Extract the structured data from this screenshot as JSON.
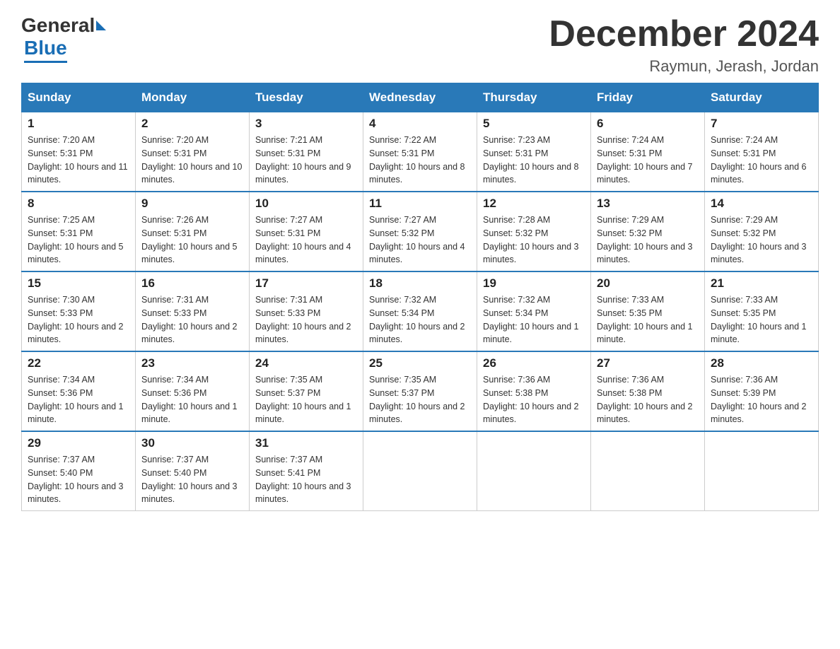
{
  "header": {
    "logo": {
      "general": "General",
      "blue": "Blue"
    },
    "title": "December 2024",
    "subtitle": "Raymun, Jerash, Jordan"
  },
  "columns": [
    "Sunday",
    "Monday",
    "Tuesday",
    "Wednesday",
    "Thursday",
    "Friday",
    "Saturday"
  ],
  "weeks": [
    [
      {
        "day": "1",
        "sunrise": "7:20 AM",
        "sunset": "5:31 PM",
        "daylight": "10 hours and 11 minutes."
      },
      {
        "day": "2",
        "sunrise": "7:20 AM",
        "sunset": "5:31 PM",
        "daylight": "10 hours and 10 minutes."
      },
      {
        "day": "3",
        "sunrise": "7:21 AM",
        "sunset": "5:31 PM",
        "daylight": "10 hours and 9 minutes."
      },
      {
        "day": "4",
        "sunrise": "7:22 AM",
        "sunset": "5:31 PM",
        "daylight": "10 hours and 8 minutes."
      },
      {
        "day": "5",
        "sunrise": "7:23 AM",
        "sunset": "5:31 PM",
        "daylight": "10 hours and 8 minutes."
      },
      {
        "day": "6",
        "sunrise": "7:24 AM",
        "sunset": "5:31 PM",
        "daylight": "10 hours and 7 minutes."
      },
      {
        "day": "7",
        "sunrise": "7:24 AM",
        "sunset": "5:31 PM",
        "daylight": "10 hours and 6 minutes."
      }
    ],
    [
      {
        "day": "8",
        "sunrise": "7:25 AM",
        "sunset": "5:31 PM",
        "daylight": "10 hours and 5 minutes."
      },
      {
        "day": "9",
        "sunrise": "7:26 AM",
        "sunset": "5:31 PM",
        "daylight": "10 hours and 5 minutes."
      },
      {
        "day": "10",
        "sunrise": "7:27 AM",
        "sunset": "5:31 PM",
        "daylight": "10 hours and 4 minutes."
      },
      {
        "day": "11",
        "sunrise": "7:27 AM",
        "sunset": "5:32 PM",
        "daylight": "10 hours and 4 minutes."
      },
      {
        "day": "12",
        "sunrise": "7:28 AM",
        "sunset": "5:32 PM",
        "daylight": "10 hours and 3 minutes."
      },
      {
        "day": "13",
        "sunrise": "7:29 AM",
        "sunset": "5:32 PM",
        "daylight": "10 hours and 3 minutes."
      },
      {
        "day": "14",
        "sunrise": "7:29 AM",
        "sunset": "5:32 PM",
        "daylight": "10 hours and 3 minutes."
      }
    ],
    [
      {
        "day": "15",
        "sunrise": "7:30 AM",
        "sunset": "5:33 PM",
        "daylight": "10 hours and 2 minutes."
      },
      {
        "day": "16",
        "sunrise": "7:31 AM",
        "sunset": "5:33 PM",
        "daylight": "10 hours and 2 minutes."
      },
      {
        "day": "17",
        "sunrise": "7:31 AM",
        "sunset": "5:33 PM",
        "daylight": "10 hours and 2 minutes."
      },
      {
        "day": "18",
        "sunrise": "7:32 AM",
        "sunset": "5:34 PM",
        "daylight": "10 hours and 2 minutes."
      },
      {
        "day": "19",
        "sunrise": "7:32 AM",
        "sunset": "5:34 PM",
        "daylight": "10 hours and 1 minute."
      },
      {
        "day": "20",
        "sunrise": "7:33 AM",
        "sunset": "5:35 PM",
        "daylight": "10 hours and 1 minute."
      },
      {
        "day": "21",
        "sunrise": "7:33 AM",
        "sunset": "5:35 PM",
        "daylight": "10 hours and 1 minute."
      }
    ],
    [
      {
        "day": "22",
        "sunrise": "7:34 AM",
        "sunset": "5:36 PM",
        "daylight": "10 hours and 1 minute."
      },
      {
        "day": "23",
        "sunrise": "7:34 AM",
        "sunset": "5:36 PM",
        "daylight": "10 hours and 1 minute."
      },
      {
        "day": "24",
        "sunrise": "7:35 AM",
        "sunset": "5:37 PM",
        "daylight": "10 hours and 1 minute."
      },
      {
        "day": "25",
        "sunrise": "7:35 AM",
        "sunset": "5:37 PM",
        "daylight": "10 hours and 2 minutes."
      },
      {
        "day": "26",
        "sunrise": "7:36 AM",
        "sunset": "5:38 PM",
        "daylight": "10 hours and 2 minutes."
      },
      {
        "day": "27",
        "sunrise": "7:36 AM",
        "sunset": "5:38 PM",
        "daylight": "10 hours and 2 minutes."
      },
      {
        "day": "28",
        "sunrise": "7:36 AM",
        "sunset": "5:39 PM",
        "daylight": "10 hours and 2 minutes."
      }
    ],
    [
      {
        "day": "29",
        "sunrise": "7:37 AM",
        "sunset": "5:40 PM",
        "daylight": "10 hours and 3 minutes."
      },
      {
        "day": "30",
        "sunrise": "7:37 AM",
        "sunset": "5:40 PM",
        "daylight": "10 hours and 3 minutes."
      },
      {
        "day": "31",
        "sunrise": "7:37 AM",
        "sunset": "5:41 PM",
        "daylight": "10 hours and 3 minutes."
      },
      null,
      null,
      null,
      null
    ]
  ]
}
